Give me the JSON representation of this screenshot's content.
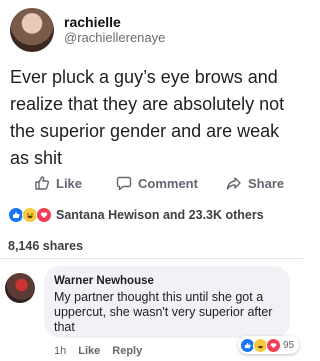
{
  "post": {
    "author": {
      "name": "rachielle",
      "handle": "@rachiellerenaye"
    },
    "text": "Ever pluck a guy’s eye brows and realize that they are absolutely not the superior gender and are weak as shit"
  },
  "actions": {
    "like_label": "Like",
    "comment_label": "Comment",
    "share_label": "Share"
  },
  "reactions": {
    "icons": [
      "like-icon",
      "haha-icon",
      "love-icon"
    ],
    "summary": "Santana Hewison and 23.3K others"
  },
  "shares": "8,146 shares",
  "comment": {
    "author": "Warner Newhouse",
    "text": "My partner thought this until she got a uppercut, she wasn't very superior after that",
    "time": "1h",
    "like_label": "Like",
    "reply_label": "Reply",
    "reaction_count": "95"
  },
  "colors": {
    "like_blue": "#1877f2",
    "haha_yellow": "#f7c93e",
    "love_red": "#f33e58"
  }
}
